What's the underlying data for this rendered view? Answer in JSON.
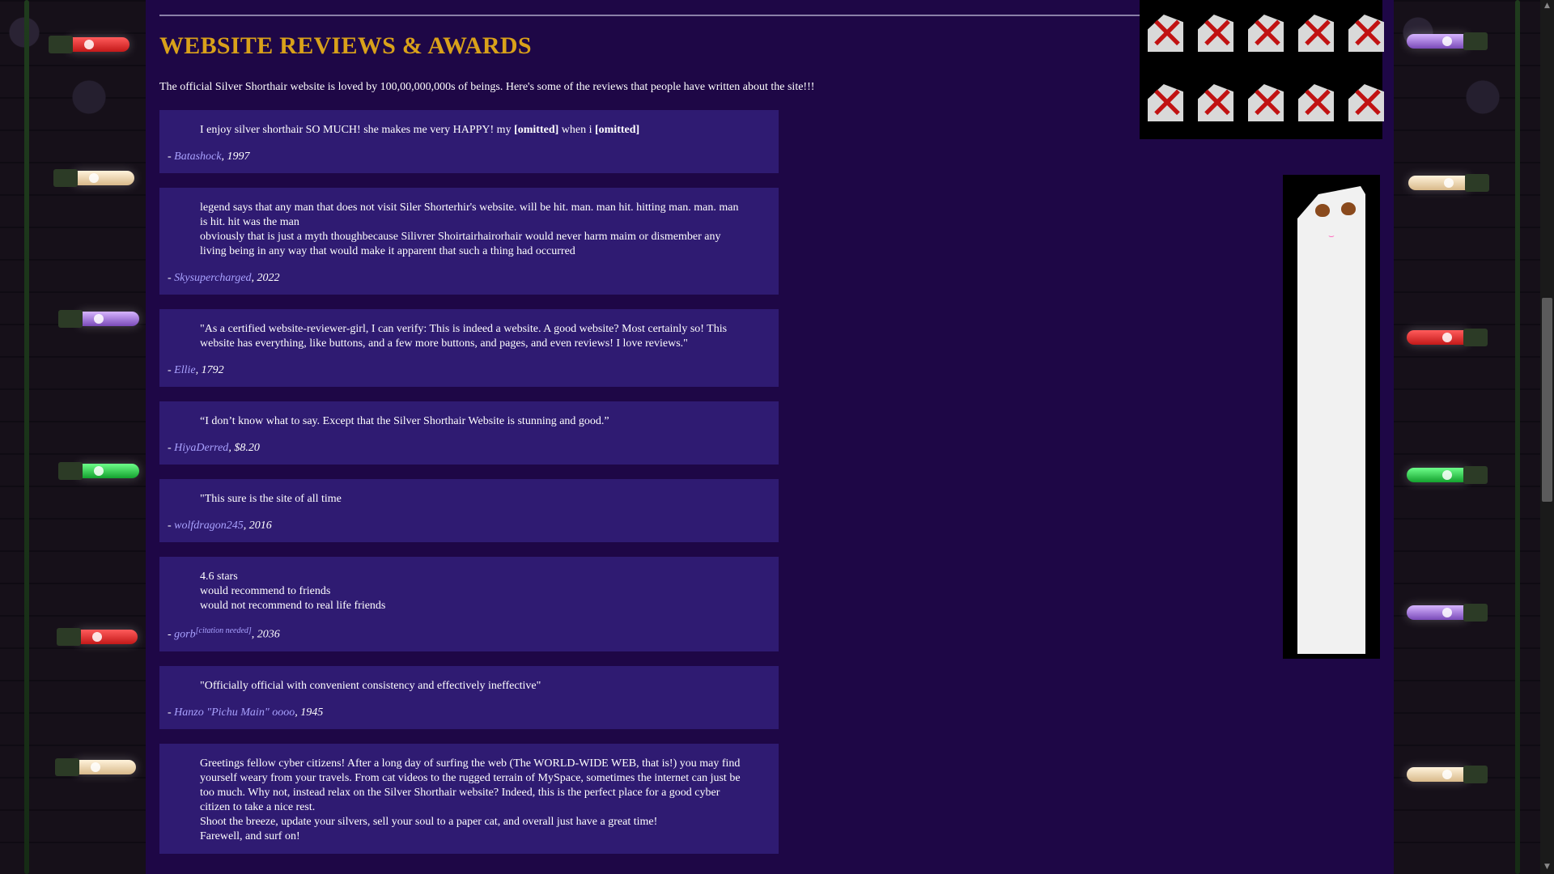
{
  "page": {
    "heading": "WEBSITE REVIEWS & AWARDS",
    "intro": "The official Silver Shorthair website is loved by 100,00,000,000s of beings. Here's some of the reviews that people have written about the site!!!"
  },
  "reviews": [
    {
      "text_before": "I enjoy silver shorthair SO MUCH! she makes me very HAPPY! my ",
      "bold1": "[omitted]",
      "text_middle": " when i ",
      "bold2": "[omitted]",
      "author": "Batashock",
      "date": ", 1997"
    },
    {
      "lines": [
        "legend says that any man that does not visit Siler Shorterhir's website. will be hit. man. man hit. hitting man. man. man is hit. hit was the man",
        "obviously that is just a myth thoughbecause Silivrer Shoirtairhairorhair would never harm maim or dismember any living being in any way that would make it apparent that such a thing had occurred"
      ],
      "author": "Skysupercharged",
      "date": ", 2022"
    },
    {
      "lines": [
        "\"As a certified website-reviewer-girl, I can verify: This is indeed a website. A good website? Most certainly so! This website has everything, like buttons, and a few more buttons, and pages, and even reviews! I love reviews.\""
      ],
      "author": "Ellie",
      "date": ", 1792"
    },
    {
      "lines": [
        "“I don’t know what to say. Except that the Silver Shorthair Website is stunning and good.”"
      ],
      "author": "HiyaDerred",
      "date": ", $8.20"
    },
    {
      "lines": [
        "\"This sure is the site of all time"
      ],
      "author": "wolfdragon245",
      "date": ", 2016"
    },
    {
      "lines": [
        "4.6 stars",
        "would recommend to friends",
        "would not recommend to real life friends"
      ],
      "author": "gorb",
      "sup": "[citation needed]",
      "date": ", 2036"
    },
    {
      "lines": [
        "\"Officially official with convenient consistency and effectively ineffective\""
      ],
      "author": "Hanzo \"Pichu Main\" oooo",
      "date": ", 1945"
    },
    {
      "lines": [
        "Greetings fellow cyber citizens! After a long day of surfing the web (The WORLD-WIDE WEB, that is!) you may find yourself weary from your travels. From cat videos to the rugged terrain of MySpace, sometimes the internet can just be too much. Why not, instead relax on the Silver Shorthair website? Indeed, this is the perfect place for a good cyber citizen to take a nice rest.",
        "Shoot the breeze, update your silvers, sell your soul to a paper cat, and overall just have a great time!",
        "Farewell, and surf on!"
      ]
    }
  ],
  "colors": {
    "background": "#1e0746",
    "card": "#2f1b72",
    "heading": "#d9a11a",
    "link": "#a9a2ff"
  },
  "icons": [
    "broken-image-icon",
    "paper-cat-image",
    "christmas-light"
  ]
}
